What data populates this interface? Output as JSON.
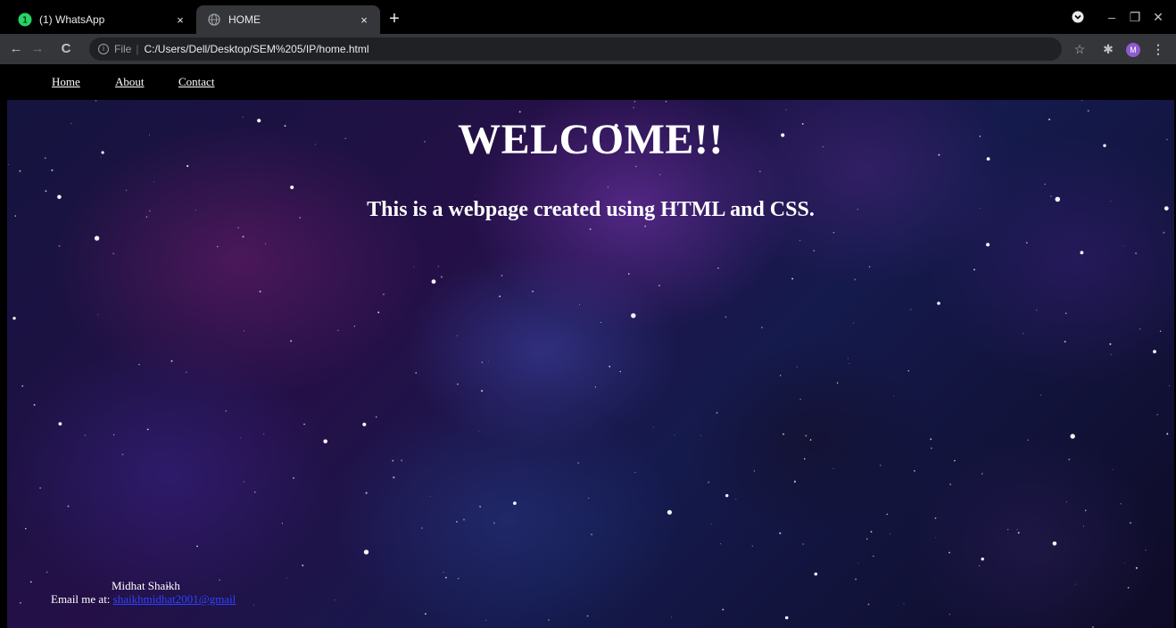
{
  "browser": {
    "tabs": [
      {
        "title": "(1) WhatsApp",
        "favicon": "whatsapp-icon",
        "badge": "1",
        "close": "×",
        "active": false
      },
      {
        "title": "HOME",
        "favicon": "globe-icon",
        "close": "×",
        "active": true
      }
    ],
    "new_tab_label": "+",
    "window_controls": {
      "minimize": "–",
      "maximize": "❐",
      "close": "✕"
    },
    "nav": {
      "back": "←",
      "forward": "→",
      "reload": "C"
    },
    "address_bar": {
      "scheme_label": "File",
      "separator": "|",
      "url": "C:/Users/Dell/Desktop/SEM%205/IP/home.html"
    },
    "toolbar_icons": {
      "bookmark": "☆",
      "extensions": "✱",
      "menu": "⋮"
    },
    "profile_initial": "M",
    "accent_color": "#8e5bd0"
  },
  "page": {
    "nav_links": [
      "Home",
      "About",
      "Contact"
    ],
    "heading": "WELCOME!!",
    "subheading": "This is a webpage created using HTML and CSS.",
    "footer": {
      "author": "Midhat Shaikh",
      "email_label": "Email me at:",
      "email_link": "shaikhmidhat2001@gmail"
    },
    "colors": {
      "nav_background": "#000000",
      "text": "#ffffff",
      "link": "#2a44ff"
    }
  }
}
